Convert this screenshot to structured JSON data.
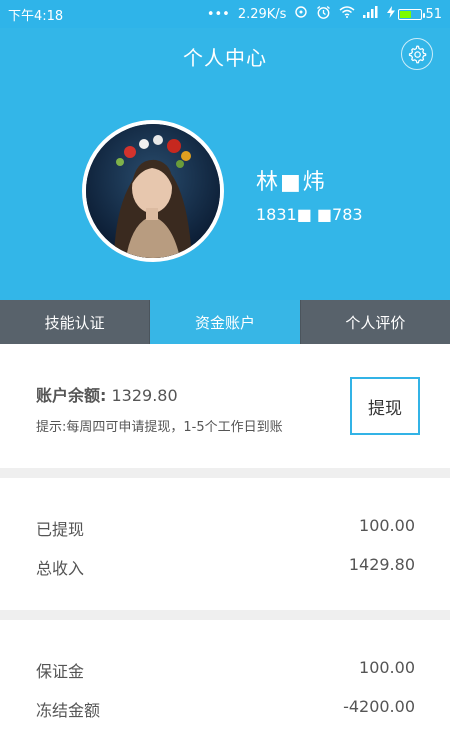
{
  "status_bar": {
    "time": "下午4:18",
    "dots": "•••",
    "network_speed": "2.29K/s",
    "battery_level": "51",
    "battery_fill": 0.51
  },
  "header": {
    "title": "个人中心",
    "settings_icon": "gear-icon"
  },
  "profile": {
    "name": "林■炜",
    "phone": "1831■ ■783"
  },
  "tabs": [
    {
      "label": "技能认证",
      "active": false
    },
    {
      "label": "资金账户",
      "active": true
    },
    {
      "label": "个人评价",
      "active": false
    }
  ],
  "balance": {
    "label": "账户余额:",
    "amount": "1329.80",
    "hint": "提示:每周四可申请提现，1-5个工作日到账",
    "withdraw_label": "提现"
  },
  "income": [
    {
      "label": "已提现",
      "value": "100.00"
    },
    {
      "label": "总收入",
      "value": "1429.80"
    }
  ],
  "deposit": [
    {
      "label": "保证金",
      "value": "100.00"
    },
    {
      "label": "冻结金额",
      "value": "-4200.00"
    }
  ],
  "colors": {
    "header_bg": "#33b6e8",
    "tab_bg": "#58626b",
    "tab_active_bg": "#37b6e6",
    "accent_border": "#32b3e6"
  }
}
